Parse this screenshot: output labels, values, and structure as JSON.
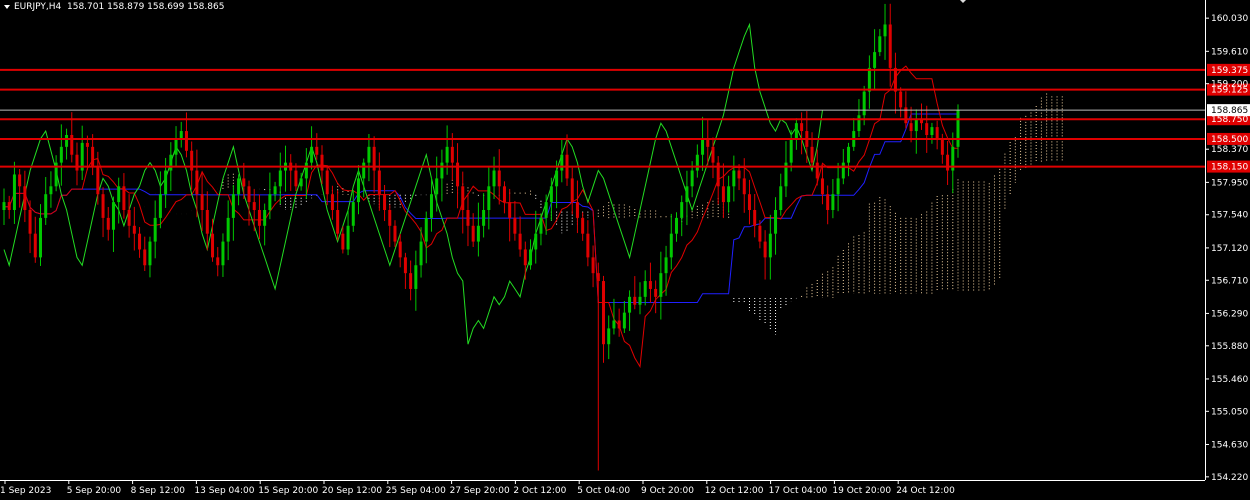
{
  "header": {
    "symbol": "EURJPY,H4",
    "ohlc": "158.701 158.879 158.699 158.865"
  },
  "chart_data": {
    "type": "candlestick",
    "title": "EURJPY,H4",
    "ylim": [
      154.18,
      160.26
    ],
    "y_ticks": [
      "160.030",
      "159.610",
      "159.200",
      "158.370",
      "157.950",
      "157.540",
      "157.120",
      "156.710",
      "156.290",
      "155.880",
      "155.460",
      "155.050",
      "154.630",
      "154.220"
    ],
    "x_ticks": [
      "1 Sep 2023",
      "5 Sep 20:00",
      "8 Sep 12:00",
      "13 Sep 04:00",
      "15 Sep 20:00",
      "20 Sep 12:00",
      "25 Sep 04:00",
      "27 Sep 20:00",
      "2 Oct 12:00",
      "5 Oct 04:00",
      "9 Oct 20:00",
      "12 Oct 12:00",
      "17 Oct 04:00",
      "19 Oct 20:00",
      "24 Oct 12:00"
    ],
    "horizontal_levels": [
      {
        "label": "159.375",
        "value": 159.375,
        "color": "#e00000"
      },
      {
        "label": "159.125",
        "value": 159.125,
        "color": "#e00000"
      },
      {
        "label": "158.750",
        "value": 158.75,
        "color": "#e00000"
      },
      {
        "label": "158.500",
        "value": 158.5,
        "color": "#e00000"
      },
      {
        "label": "158.150",
        "value": 158.15,
        "color": "#e00000"
      }
    ],
    "current_price": {
      "label": "158.865",
      "value": 158.865
    },
    "colors": {
      "bull": "#00c800",
      "bear": "#e00000",
      "level": "#e00000",
      "kijun": "#2020ff",
      "tenkan": "#e00000",
      "chikou": "#22dd22",
      "cloud_a": "#f0d0a0",
      "cloud_b": "#ffffff"
    },
    "closes": [
      157.7,
      157.6,
      158.05,
      157.9,
      157.6,
      157.3,
      157.0,
      157.5,
      157.8,
      157.9,
      158.2,
      158.4,
      158.55,
      158.3,
      158.1,
      158.45,
      158.4,
      158.15,
      157.8,
      157.5,
      157.35,
      157.7,
      157.9,
      157.6,
      157.4,
      157.3,
      157.1,
      156.9,
      157.2,
      157.5,
      157.8,
      158.1,
      158.3,
      158.5,
      158.6,
      158.35,
      158.1,
      157.8,
      157.6,
      157.3,
      157.0,
      156.9,
      157.2,
      157.5,
      157.8,
      158.0,
      157.9,
      157.7,
      157.6,
      157.4,
      157.6,
      157.8,
      157.9,
      158.1,
      158.2,
      158.1,
      157.9,
      158.0,
      158.2,
      158.4,
      158.3,
      158.1,
      157.8,
      157.6,
      157.3,
      157.1,
      157.4,
      157.7,
      158.0,
      158.2,
      158.4,
      158.1,
      157.8,
      157.6,
      157.4,
      157.2,
      157.0,
      156.8,
      156.6,
      156.9,
      157.2,
      157.5,
      157.8,
      158.0,
      158.2,
      158.4,
      158.2,
      157.9,
      157.6,
      157.4,
      157.2,
      157.4,
      157.6,
      157.9,
      158.1,
      157.9,
      157.7,
      157.5,
      157.3,
      157.1,
      156.9,
      157.1,
      157.3,
      157.5,
      157.7,
      157.9,
      158.1,
      158.3,
      158.0,
      157.7,
      157.5,
      157.3,
      157.0,
      156.8,
      156.7,
      155.9,
      156.1,
      156.2,
      156.1,
      156.3,
      156.5,
      156.4,
      156.5,
      156.7,
      156.6,
      156.5,
      156.8,
      157.0,
      157.3,
      157.5,
      157.7,
      157.9,
      158.1,
      158.3,
      158.5,
      158.4,
      158.2,
      157.9,
      157.7,
      157.9,
      158.1,
      158.0,
      157.8,
      157.6,
      157.4,
      157.2,
      157.0,
      157.3,
      157.6,
      157.9,
      158.2,
      158.5,
      158.7,
      158.6,
      158.4,
      158.2,
      158.0,
      157.8,
      157.6,
      157.8,
      158.0,
      158.2,
      158.4,
      158.6,
      158.8,
      159.1,
      159.4,
      159.6,
      159.8,
      159.95,
      159.4,
      159.1,
      158.9,
      158.7,
      158.6,
      158.75,
      158.7,
      158.55,
      158.65,
      158.5,
      158.3,
      158.1,
      158.4,
      158.865
    ]
  }
}
